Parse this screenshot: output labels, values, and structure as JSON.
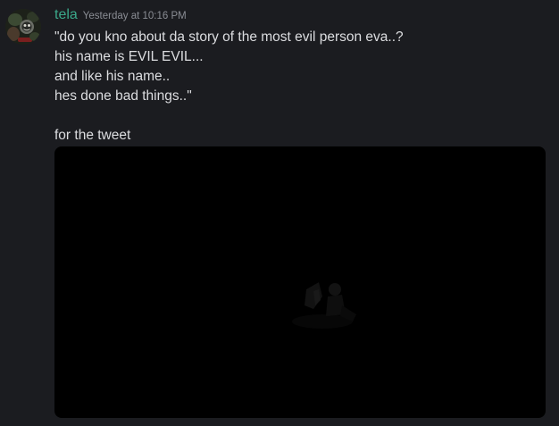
{
  "message": {
    "author": {
      "name": "tela",
      "name_color": "#3ba88a",
      "avatar_icon": "user-avatar"
    },
    "timestamp": "Yesterday at 10:16 PM",
    "lines": [
      "\"do you kno about da story of the most evil person eva..?",
      "his name is EVIL EVIL...",
      "and like his name..",
      "hes done bad things..\"",
      "",
      "for the tweet"
    ],
    "attachment": {
      "type": "video",
      "background": "#000000"
    }
  },
  "colors": {
    "background": "#1b1c20",
    "text": "#dcdde0",
    "muted": "#8a8d94"
  }
}
